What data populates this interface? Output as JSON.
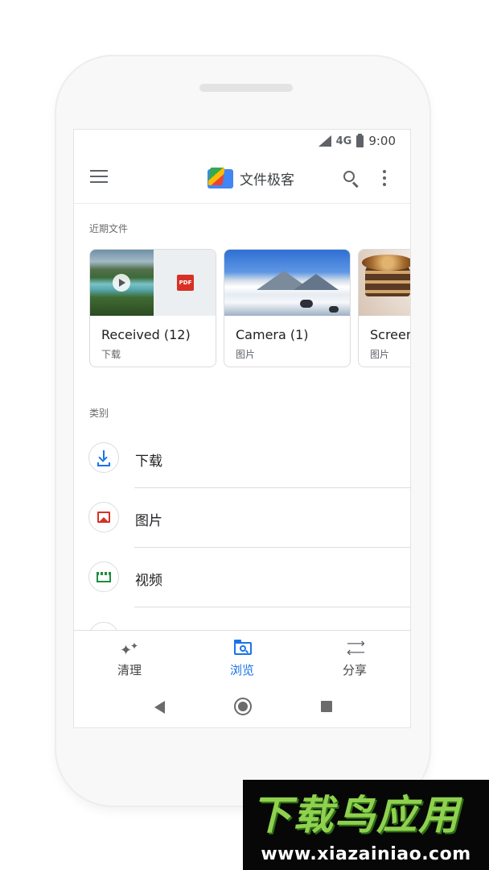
{
  "status_bar": {
    "network": "4G",
    "time": "9:00"
  },
  "app_bar": {
    "title": "文件极客"
  },
  "recent": {
    "label": "近期文件",
    "cards": [
      {
        "title": "Received (12)",
        "subtitle": "下载",
        "pdf_badge": "PDF"
      },
      {
        "title": "Camera (1)",
        "subtitle": "图片"
      },
      {
        "title": "Screen",
        "subtitle": "图片"
      }
    ]
  },
  "categories": {
    "label": "类别",
    "items": [
      {
        "label": "下载",
        "icon": "download-icon",
        "color": "#1a73e8"
      },
      {
        "label": "图片",
        "icon": "image-icon",
        "color": "#d93025"
      },
      {
        "label": "视频",
        "icon": "video-icon",
        "color": "#1e8e3e"
      }
    ]
  },
  "bottom_nav": {
    "items": [
      {
        "label": "清理",
        "icon": "sparkle-icon",
        "active": false
      },
      {
        "label": "浏览",
        "icon": "folder-search-icon",
        "active": true
      },
      {
        "label": "分享",
        "icon": "swap-arrows-icon",
        "active": false
      }
    ]
  },
  "watermark": {
    "title": "下载鸟应用",
    "url": "www.xiazainiao.com"
  },
  "colors": {
    "accent": "#1a73e8",
    "watermark_green": "#8fd14f"
  }
}
